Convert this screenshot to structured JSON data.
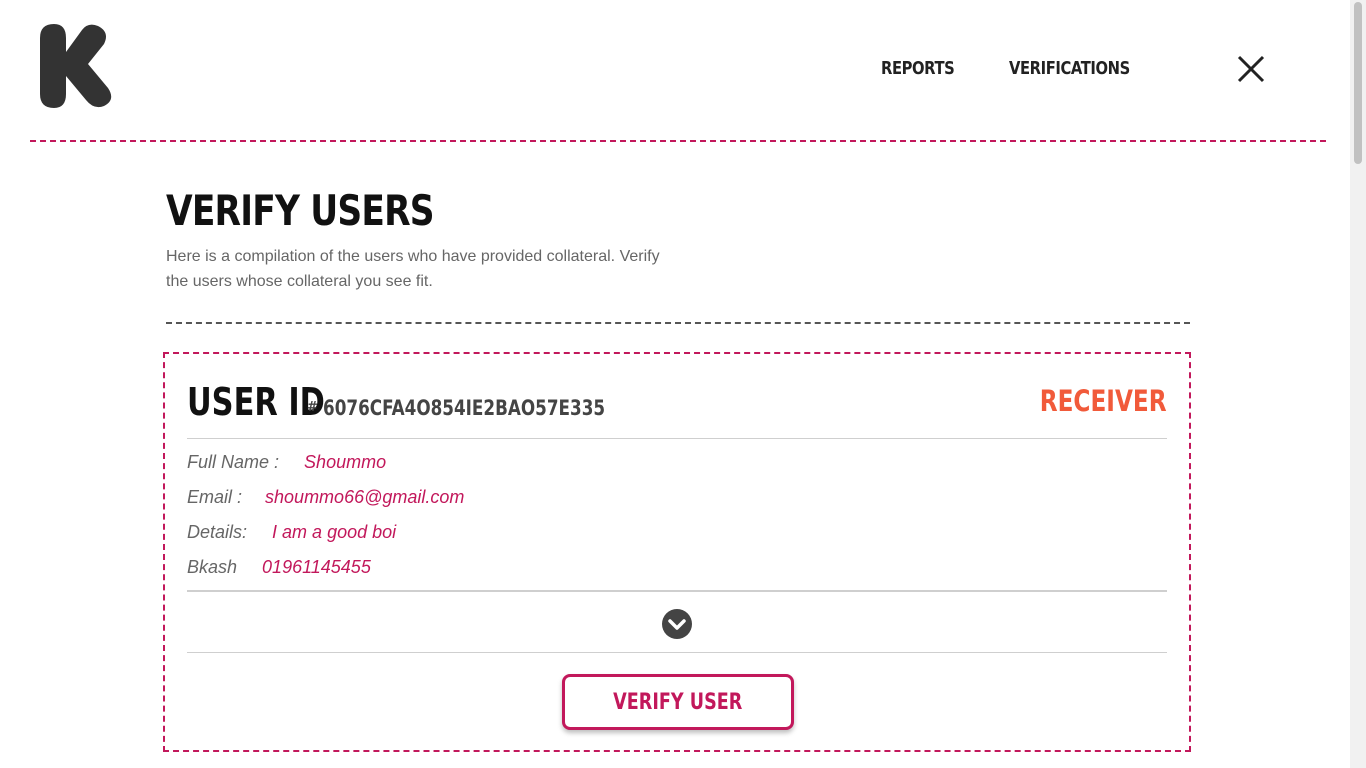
{
  "header": {
    "logo_icon": "k-logo-icon",
    "nav": [
      {
        "label": "REPORTS"
      },
      {
        "label": "VERIFICATIONS"
      }
    ],
    "close_icon": "close-icon"
  },
  "page": {
    "title": "VERIFY USERS",
    "description": "Here is a compilation of the users who have provided collateral. Verify the users whose collateral you see fit."
  },
  "card": {
    "id_label": "USER ID",
    "id_hash": "#",
    "id_value": "6076CFA4O854IE2BAO57E335",
    "role": "RECEIVER",
    "fields": [
      {
        "key": "Full Name :",
        "value": "Shoummo"
      },
      {
        "key": "Email :",
        "value": "shoummo66@gmail.com"
      },
      {
        "key": "Details:",
        "value": "I am a good boi"
      },
      {
        "key": "Bkash",
        "value": "01961145455"
      }
    ],
    "expand_icon": "chevron-down-icon",
    "verify_label": "VERIFY USER"
  },
  "colors": {
    "accent": "#c2185b",
    "role": "#f15a3a",
    "text": "#222222",
    "muted": "#666666"
  }
}
